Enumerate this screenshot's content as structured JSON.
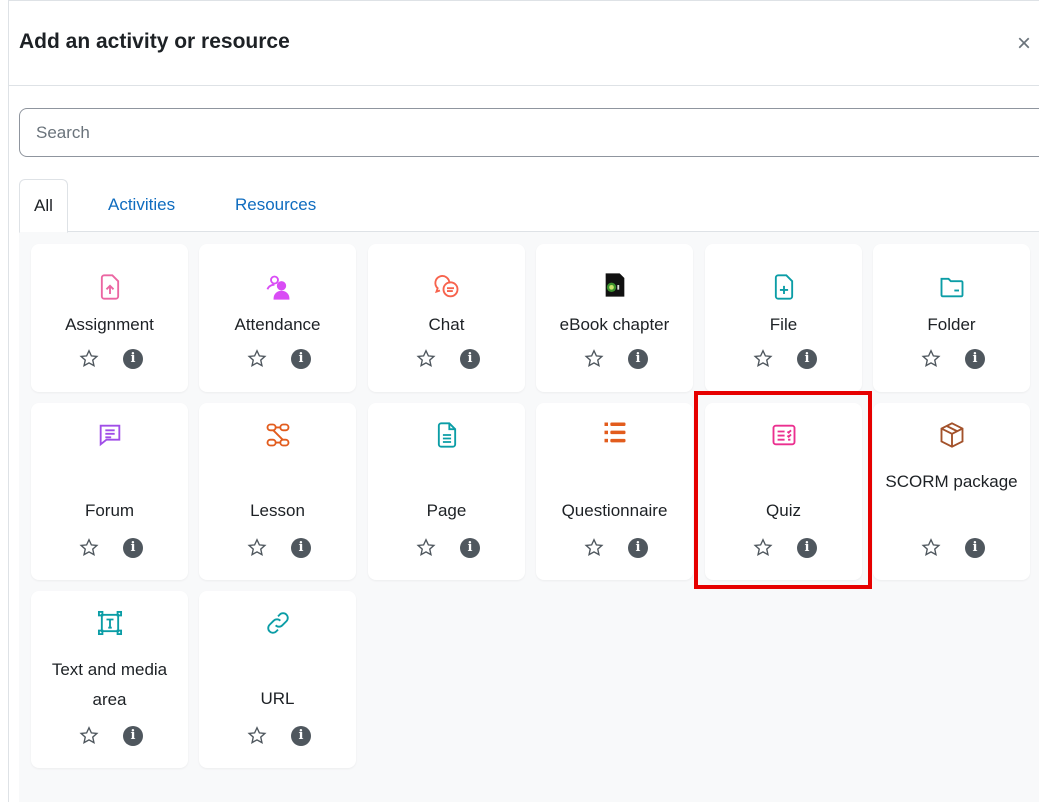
{
  "modal": {
    "title": "Add an activity or resource",
    "close_glyph": "×"
  },
  "search": {
    "placeholder": "Search",
    "value": ""
  },
  "tabs": [
    {
      "label": "All",
      "active": true
    },
    {
      "label": "Activities",
      "active": false
    },
    {
      "label": "Resources",
      "active": false
    }
  ],
  "colors": {
    "assessment": "#eb66a2",
    "collaboration": "#f7634d",
    "communication": "#11a676",
    "content": "#0b9da6",
    "interactive": "#e25c1d",
    "highlight": "#e60000",
    "link": "#0f6cbf"
  },
  "items": [
    {
      "label": "Assignment",
      "icon": "assignment-upload-icon",
      "color": "#eb66a2"
    },
    {
      "label": "Attendance",
      "icon": "attendance-people-icon",
      "color": "#d94df5"
    },
    {
      "label": "Chat",
      "icon": "chat-bubbles-icon",
      "color": "#f7634d"
    },
    {
      "label": "eBook chapter",
      "icon": "ebook-chapter-icon",
      "color": "#000000"
    },
    {
      "label": "File",
      "icon": "file-plus-icon",
      "color": "#0b9da6"
    },
    {
      "label": "Folder",
      "icon": "folder-icon",
      "color": "#0b9da6"
    },
    {
      "label": "Forum",
      "icon": "forum-speech-icon",
      "color": "#a04ee8"
    },
    {
      "label": "Lesson",
      "icon": "lesson-nodes-icon",
      "color": "#e25c1d"
    },
    {
      "label": "Page",
      "icon": "page-document-icon",
      "color": "#0b9da6"
    },
    {
      "label": "Questionnaire",
      "icon": "questionnaire-list-icon",
      "color": "#e25c1d"
    },
    {
      "label": "Quiz",
      "icon": "quiz-checklist-icon",
      "color": "#eb2f8f"
    },
    {
      "label": "SCORM package",
      "icon": "scorm-package-box-icon",
      "color": "#a3522b"
    },
    {
      "label": "Text and media area",
      "icon": "text-media-area-icon",
      "color": "#0b9da6"
    },
    {
      "label": "URL",
      "icon": "url-link-icon",
      "color": "#0b9da6"
    }
  ],
  "highlighted_item": "Quiz"
}
